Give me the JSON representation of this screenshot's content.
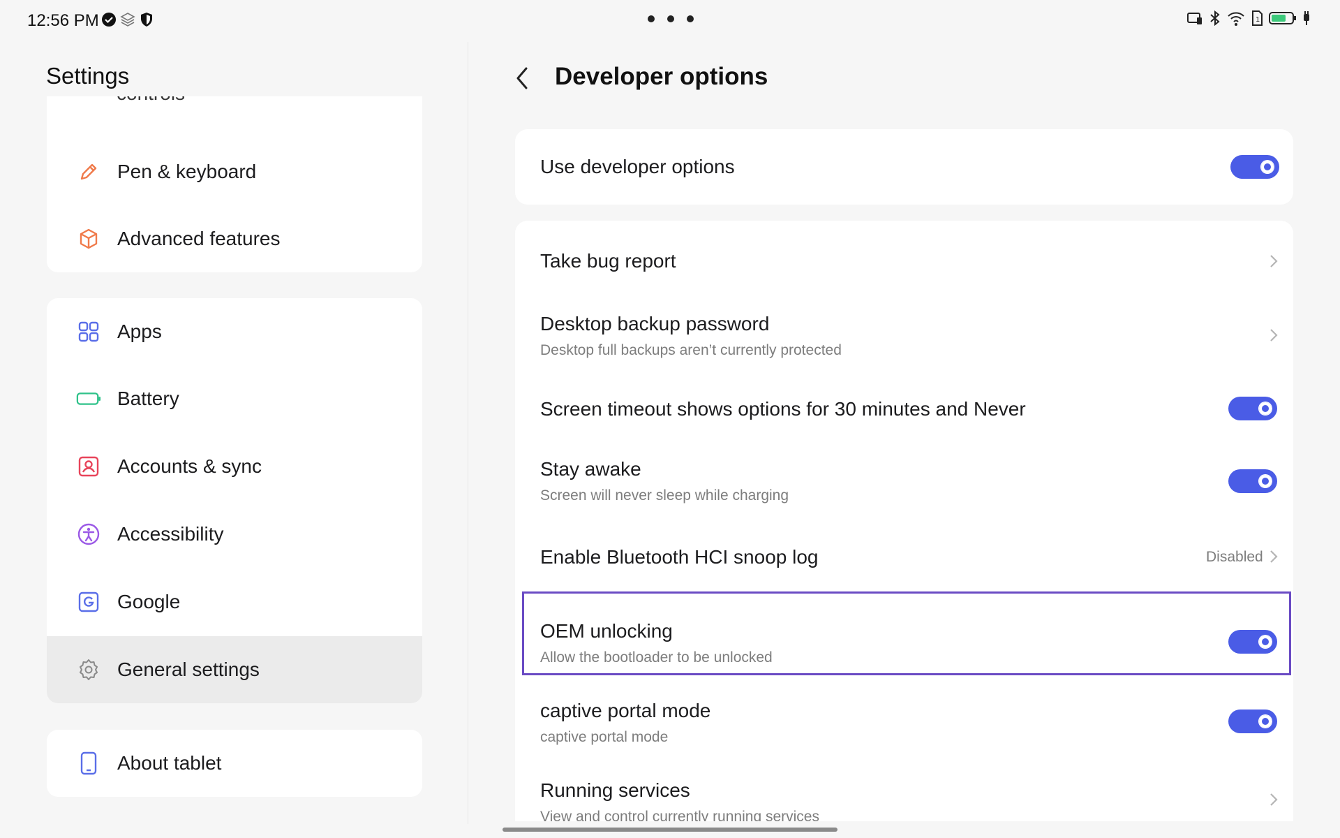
{
  "status_bar": {
    "time": "12:56 PM",
    "left_icons": [
      "check-circle-icon",
      "layers-icon",
      "shield-icon"
    ],
    "right_icons": [
      "cast-icon",
      "bluetooth-icon",
      "wifi-icon",
      "sim-icon",
      "battery-icon",
      "charging-icon"
    ],
    "battery_color": "#3cc97a"
  },
  "left_pane": {
    "title": "Settings",
    "cut_item": "controls",
    "group1": [
      {
        "label": "Pen & keyboard",
        "icon": "pen-icon",
        "color": "#f07a4a"
      },
      {
        "label": "Advanced features",
        "icon": "cube-icon",
        "color": "#f07a4a"
      }
    ],
    "group2": [
      {
        "label": "Apps",
        "icon": "apps-grid-icon",
        "color": "#5a6ee8"
      },
      {
        "label": "Battery",
        "icon": "battery-icon",
        "color": "#2fc28a"
      },
      {
        "label": "Accounts & sync",
        "icon": "account-icon",
        "color": "#e8445a"
      },
      {
        "label": "Accessibility",
        "icon": "accessibility-icon",
        "color": "#9b59e6"
      },
      {
        "label": "Google",
        "icon": "google-icon",
        "color": "#5a6ee8"
      },
      {
        "label": "General settings",
        "icon": "gear-icon",
        "color": "#8a8a8a",
        "selected": true
      }
    ],
    "group3": [
      {
        "label": "About tablet",
        "icon": "tablet-icon",
        "color": "#5a6ee8"
      }
    ]
  },
  "right_pane": {
    "title": "Developer options",
    "master": {
      "title": "Use developer options",
      "on": true
    },
    "rows": [
      {
        "title": "Take bug report",
        "type": "chevron"
      },
      {
        "title": "Desktop backup password",
        "subtitle": "Desktop full backups aren’t currently protected",
        "type": "chevron"
      },
      {
        "title": "Screen timeout shows options for 30 minutes and Never",
        "type": "toggle",
        "on": true
      },
      {
        "title": "Stay awake",
        "subtitle": "Screen will never sleep while charging",
        "type": "toggle",
        "on": true
      },
      {
        "title": "Enable Bluetooth HCI snoop log",
        "value": "Disabled",
        "type": "chevron"
      },
      {
        "title": "OEM unlocking",
        "subtitle": "Allow the bootloader to be unlocked",
        "type": "toggle",
        "on": true,
        "highlighted": true
      },
      {
        "title": "captive portal mode",
        "subtitle": "captive portal mode",
        "type": "toggle",
        "on": true
      },
      {
        "title": "Running services",
        "subtitle": "View and control currently running services",
        "type": "chevron"
      }
    ],
    "accent_color": "#4a5ce6",
    "highlight_color": "#6a4bc4"
  }
}
